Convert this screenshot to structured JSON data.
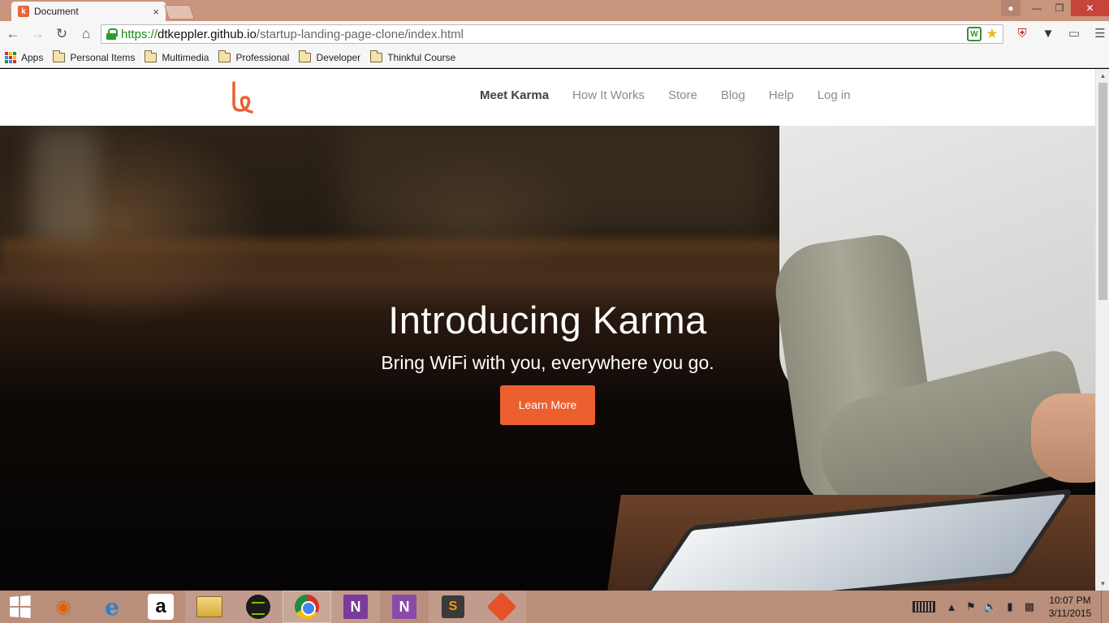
{
  "browser": {
    "tab_title": "Document",
    "tab_close": "×",
    "url": {
      "scheme": "https://",
      "host": "dtkeppler.github.io",
      "path": "/startup-landing-page-clone/index.html"
    },
    "bookmarks": [
      {
        "label": "Apps",
        "icon": "apps-grid-icon"
      },
      {
        "label": "Personal Items",
        "icon": "folder-icon"
      },
      {
        "label": "Multimedia",
        "icon": "folder-icon"
      },
      {
        "label": "Professional",
        "icon": "folder-icon"
      },
      {
        "label": "Developer",
        "icon": "folder-icon"
      },
      {
        "label": "Thinkful Course",
        "icon": "folder-icon"
      }
    ]
  },
  "site": {
    "nav": [
      {
        "label": "Meet Karma",
        "active": true
      },
      {
        "label": "How It Works",
        "active": false
      },
      {
        "label": "Store",
        "active": false
      },
      {
        "label": "Blog",
        "active": false
      },
      {
        "label": "Help",
        "active": false
      },
      {
        "label": "Log in",
        "active": false
      }
    ],
    "hero": {
      "title": "Introducing Karma",
      "subtitle": "Bring WiFi with you, everywhere you go.",
      "cta_label": "Learn More"
    }
  },
  "taskbar": {
    "apps": [
      "firefox-icon",
      "internet-explorer-icon",
      "amazon-icon",
      "file-explorer-icon",
      "spotify-icon",
      "chrome-icon",
      "onenote-icon",
      "onenote-clipper-icon",
      "sublime-text-icon",
      "git-icon"
    ],
    "clock_time": "10:07 PM",
    "clock_date": "3/11/2015"
  },
  "colors": {
    "brand_orange": "#ec5f2f",
    "titlebar": "#c9957c",
    "taskbar": "#b98e7b"
  }
}
